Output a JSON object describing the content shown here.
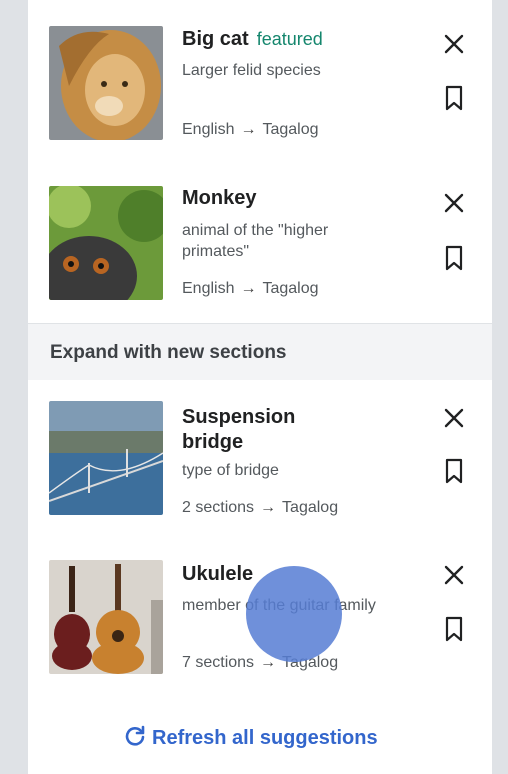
{
  "cards_top": [
    {
      "title": "Big cat",
      "badge": "featured",
      "desc": "Larger felid species",
      "from": "English",
      "to": "Tagalog"
    },
    {
      "title": "Monkey",
      "desc": "animal of the \"higher primates\"",
      "from": "English",
      "to": "Tagalog"
    }
  ],
  "section_header": "Expand with new sections",
  "cards_bottom": [
    {
      "title": "Suspension bridge",
      "desc": "type of bridge",
      "from": "2 sections",
      "to": "Tagalog"
    },
    {
      "title": "Ukulele",
      "desc": "member of the guitar family",
      "from": "7 sections",
      "to": "Tagalog"
    }
  ],
  "refresh_label": "Refresh all suggestions",
  "icons": {
    "close": "close-icon",
    "bookmark": "bookmark-icon",
    "refresh": "refresh-icon",
    "arrow": "arrow-right-icon"
  },
  "colors": {
    "featured": "#14866d",
    "link": "#3366cc",
    "touch": "#567dd4"
  }
}
